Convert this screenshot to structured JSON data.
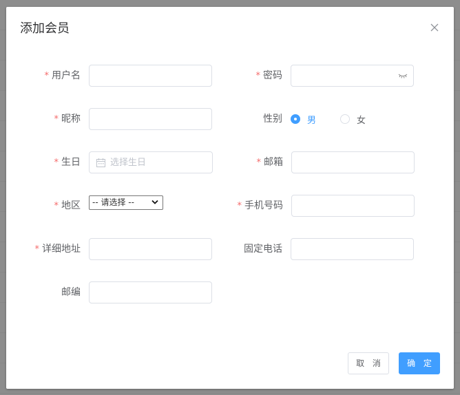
{
  "dialog": {
    "title": "添加会员",
    "close_icon": "close-icon"
  },
  "form": {
    "username": {
      "label": "用户名",
      "required": "*",
      "value": ""
    },
    "password": {
      "label": "密码",
      "required": "*",
      "value": "",
      "icon": "eye-closed-icon"
    },
    "nickname": {
      "label": "昵称",
      "required": "*",
      "value": ""
    },
    "gender": {
      "label": "性别",
      "options": [
        "男",
        "女"
      ],
      "selected": "男"
    },
    "birthday": {
      "label": "生日",
      "required": "*",
      "placeholder": "选择生日",
      "icon": "calendar-icon"
    },
    "email": {
      "label": "邮箱",
      "required": "*",
      "value": ""
    },
    "region": {
      "label": "地区",
      "required": "*",
      "selected": "-- 请选择 --"
    },
    "phone": {
      "label": "手机号码",
      "required": "*",
      "value": ""
    },
    "address": {
      "label": "详细地址",
      "required": "*",
      "value": ""
    },
    "landline": {
      "label": "固定电话",
      "value": ""
    },
    "zipcode": {
      "label": "邮编",
      "value": ""
    }
  },
  "footer": {
    "cancel_label": "取 消",
    "ok_label": "确 定"
  },
  "colors": {
    "primary": "#409eff",
    "required": "#f56c6c",
    "label": "#606266",
    "border": "#dcdfe6"
  }
}
